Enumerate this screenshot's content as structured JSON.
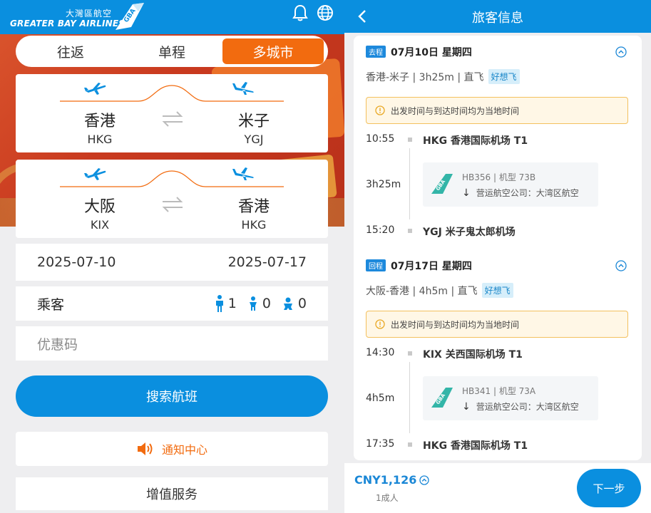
{
  "left": {
    "brand": {
      "cn": "大灣區航空",
      "en": "GREATER BAY AIRLINES"
    },
    "tabs": [
      {
        "label": "往返",
        "active": false
      },
      {
        "label": "单程",
        "active": false
      },
      {
        "label": "多城市",
        "active": true
      }
    ],
    "routes": [
      {
        "from_city": "香港",
        "from_code": "HKG",
        "to_city": "米子",
        "to_code": "YGJ"
      },
      {
        "from_city": "大阪",
        "from_code": "KIX",
        "to_city": "香港",
        "to_code": "HKG"
      }
    ],
    "dates": {
      "depart": "2025-07-10",
      "return": "2025-07-17"
    },
    "passengers": {
      "label": "乘客",
      "adults": "1",
      "children": "0",
      "infants": "0"
    },
    "promo_placeholder": "优惠码",
    "search_label": "搜索航班",
    "notify_label": "通知中心",
    "value_added_label": "增值服务"
  },
  "right": {
    "title": "旅客信息",
    "segments": [
      {
        "badge": "去程",
        "date": "07月10日 星期四",
        "summary": "香港-米子 | 3h25m | 直飞",
        "tag": "好想飞",
        "notice": "出发时间与到达时间均为当地时间",
        "dep_time": "10:55",
        "dep_airport": "HKG 香港国际机场 T1",
        "duration": "3h25m",
        "flight": "HB356 | 机型 73B",
        "operator": "营运航空公司：大湾区航空",
        "arr_time": "15:20",
        "arr_airport": "YGJ 米子鬼太郎机场"
      },
      {
        "badge": "回程",
        "date": "07月17日 星期四",
        "summary": "大阪-香港 | 4h5m | 直飞",
        "tag": "好想飞",
        "notice": "出发时间与到达时间均为当地时间",
        "dep_time": "14:30",
        "dep_airport": "KIX 关西国际机场 T1",
        "duration": "4h5m",
        "flight": "HB341 | 机型 73A",
        "operator": "营运航空公司：大湾区航空",
        "arr_time": "17:35",
        "arr_airport": "HKG 香港国际机场 T1"
      }
    ],
    "footer": {
      "price": "CNY1,126",
      "pax": "1成人",
      "next_label": "下一步"
    }
  },
  "colors": {
    "brand_blue": "#0a8fdf",
    "accent_orange": "#f26b0f",
    "notice_bg": "#fff7e6"
  }
}
